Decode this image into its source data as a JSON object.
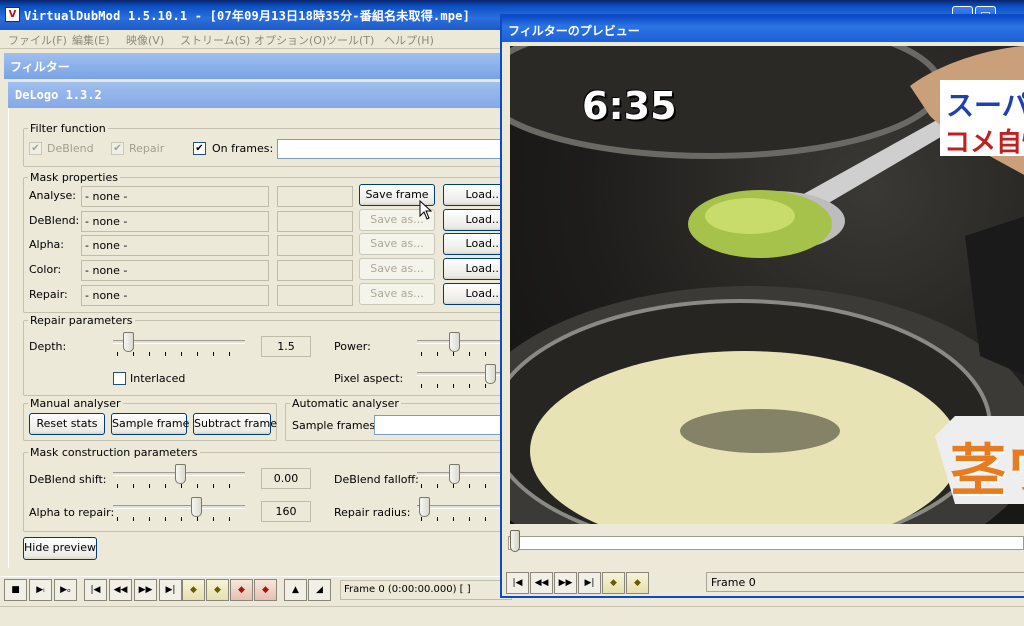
{
  "main_window": {
    "title": "VirtualDubMod 1.5.10.1 - [07年09月13日18時35分-番組名未取得.mpe]",
    "icon_glyph": "V"
  },
  "menu": [
    "ファイル(F)",
    "編集(E)",
    "映像(V)",
    "ストリーム(S)",
    "オプション(O)",
    "ツール(T)",
    "ヘルプ(H)"
  ],
  "filters_window": {
    "title": "フィルター"
  },
  "delogo": {
    "title": "DeLogo 1.3.2",
    "filter_function": {
      "legend": "Filter function",
      "deblend": "DeBlend",
      "repair": "Repair",
      "on_frames": "On frames:",
      "on_frames_value": ""
    },
    "mask_properties": {
      "legend": "Mask properties",
      "rows": [
        {
          "label": "Analyse:",
          "value": "- none -",
          "save": "Save frame",
          "load": "Load..."
        },
        {
          "label": "DeBlend:",
          "value": "- none -",
          "save": "Save as...",
          "load": "Load..."
        },
        {
          "label": "Alpha:",
          "value": "- none -",
          "save": "Save as...",
          "load": "Load..."
        },
        {
          "label": "Color:",
          "value": "- none -",
          "save": "Save as...",
          "load": "Load..."
        },
        {
          "label": "Repair:",
          "value": "- none -",
          "save": "Save as...",
          "load": "Load..."
        }
      ]
    },
    "repair_parameters": {
      "legend": "Repair parameters",
      "depth_label": "Depth:",
      "depth_value": "1.5",
      "power_label": "Power:",
      "interlaced_label": "Interlaced",
      "pixel_aspect_label": "Pixel aspect:"
    },
    "manual_analyser": {
      "legend": "Manual analyser",
      "reset": "Reset stats",
      "sample": "Sample frame",
      "subtract": "Subtract frame"
    },
    "automatic_analyser": {
      "legend": "Automatic analyser",
      "sample_frames_label": "Sample frames:",
      "sample_frames_value": ""
    },
    "mask_construction": {
      "legend": "Mask construction parameters",
      "deblend_shift_label": "DeBlend shift:",
      "deblend_shift_value": "0.00",
      "deblend_falloff_label": "DeBlend falloff:",
      "alpha_to_repair_label": "Alpha to repair:",
      "alpha_to_repair_value": "160",
      "repair_radius_label": "Repair radius:"
    },
    "hide_preview": "Hide preview"
  },
  "toolbar": {
    "frame_status": "Frame 0  (0:00:00.000)  [ ]"
  },
  "preview": {
    "title": "フィルターのプレビュー",
    "frame_label": "Frame 0",
    "video_overlay": {
      "time": "6:35",
      "banner_top": "スーパー",
      "banner_mid": "コメ自慢",
      "banner_bottom": "茎ワ"
    }
  },
  "colors": {
    "titlebar": "#0a4fc4",
    "inactive_title": "#8fb0ea",
    "dialog_bg": "#ece9d8"
  }
}
